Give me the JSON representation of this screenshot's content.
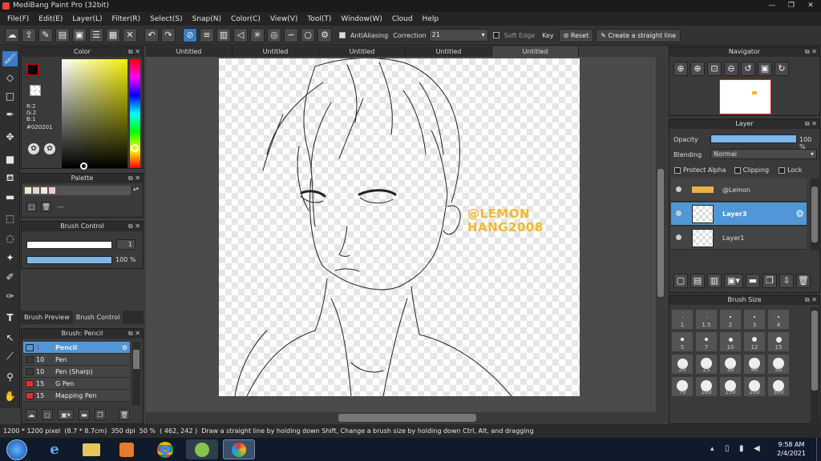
{
  "window": {
    "title": "MediBang Paint Pro (32bit)"
  },
  "menu": [
    "File(F)",
    "Edit(E)",
    "Layer(L)",
    "Filter(R)",
    "Select(S)",
    "Snap(N)",
    "Color(C)",
    "View(V)",
    "Tool(T)",
    "Window(W)",
    "Cloud",
    "Help"
  ],
  "toolbar": {
    "antialiasing_label": "AntiAliasing",
    "correction_label": "Correction",
    "correction_value": "21",
    "soft_edge_label": "Soft Edge",
    "key_label": "Key",
    "reset_label": "Reset",
    "straight_line_label": "Create a straight line"
  },
  "tabs": [
    "Untitled",
    "Untitled",
    "Untitled",
    "Untitled",
    "Untitled"
  ],
  "color_panel": {
    "title": "Color",
    "r": "R:2",
    "g": "G:2",
    "b": "B:1",
    "hex": "#020201",
    "foreground": "#020201",
    "accent": "#c40000"
  },
  "palette_panel": {
    "title": "Palette",
    "count": "---"
  },
  "brush_control": {
    "title": "Brush Control",
    "size_value": "1",
    "opacity_value": "100 %"
  },
  "brush_tabs": {
    "preview": "Brush Preview",
    "control": "Brush Control"
  },
  "brush_list": {
    "title": "Brush: Pencil",
    "items": [
      {
        "size": "1",
        "name": "Pencil",
        "color": "#4f97d6"
      },
      {
        "size": "10",
        "name": "Pen",
        "color": "#3a3a3a"
      },
      {
        "size": "10",
        "name": "Pen (Sharp)",
        "color": "#3a3a3a"
      },
      {
        "size": "15",
        "name": "G Pen",
        "color": "#e03030"
      },
      {
        "size": "15",
        "name": "Mapping Pen",
        "color": "#e03030"
      }
    ]
  },
  "navigator": {
    "title": "Navigator"
  },
  "layer_panel": {
    "title": "Layer",
    "opacity_label": "Opacity",
    "opacity_value": "100 %",
    "opacity_level": 1.0,
    "blending_label": "Blending",
    "blending_value": "Normal",
    "protect_alpha": "Protect Alpha",
    "clipping": "Clipping",
    "lock": "Lock",
    "layers": [
      {
        "name": "@Lemon"
      },
      {
        "name": "Layer3"
      },
      {
        "name": "Layer1"
      }
    ]
  },
  "brush_size": {
    "title": "Brush Size",
    "sizes": [
      "1",
      "1.5",
      "2",
      "3",
      "4",
      "5",
      "7",
      "10",
      "12",
      "15",
      "20",
      "25",
      "30",
      "40",
      "50",
      "70",
      "100",
      "150",
      "200",
      "300"
    ]
  },
  "canvas": {
    "watermark_line1": "@LEMON",
    "watermark_line2": "HANG2008",
    "watermark_color": "#f2b92f"
  },
  "status": {
    "size": "1200 * 1200 pixel",
    "cm": "(8.7 * 8.7cm)",
    "dpi": "350 dpi",
    "zoom": "50 %",
    "coords": "( 462, 242 )",
    "hint": "Draw a straight line by holding down Shift, Change a brush size by holding down Ctrl, Alt, and dragging"
  },
  "taskbar": {
    "time": "9:58 AM",
    "date": "2/4/2021"
  }
}
